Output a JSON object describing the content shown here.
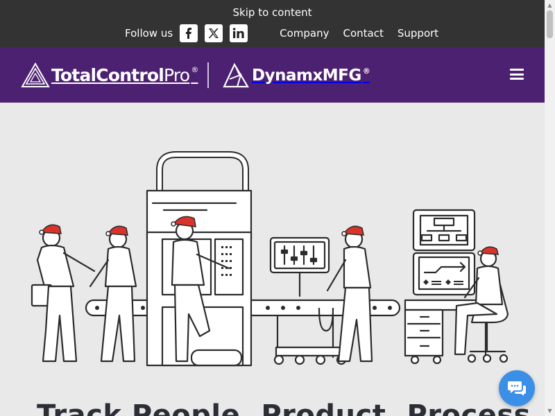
{
  "topbar": {
    "skip_link": "Skip to content",
    "follow_label": "Follow us",
    "social": [
      {
        "icon": "facebook-icon",
        "glyph": "f"
      },
      {
        "icon": "x-twitter-icon",
        "glyph": "X"
      },
      {
        "icon": "linkedin-icon",
        "glyph": "in"
      }
    ],
    "nav": [
      "Company",
      "Contact",
      "Support"
    ]
  },
  "header": {
    "logo1": {
      "light": "TotalControl",
      "bold_part": "Pro",
      "reg": "®"
    },
    "logo2": {
      "text": "DynamxMFG",
      "reg": "®"
    },
    "menu_icon": "hamburger-menu-icon"
  },
  "hero": {
    "illustration": "factory-workers-illustration",
    "headline": "Track People. Product. Process."
  },
  "chat": {
    "icon": "chat-bubble-icon"
  },
  "colors": {
    "topbar_bg": "#333333",
    "header_bg": "#4d2172",
    "hero_bg": "#e9e9ea",
    "headline": "#2b2e35",
    "chat_bg": "#3b8fe6",
    "santa_hat": "#d9342b"
  }
}
